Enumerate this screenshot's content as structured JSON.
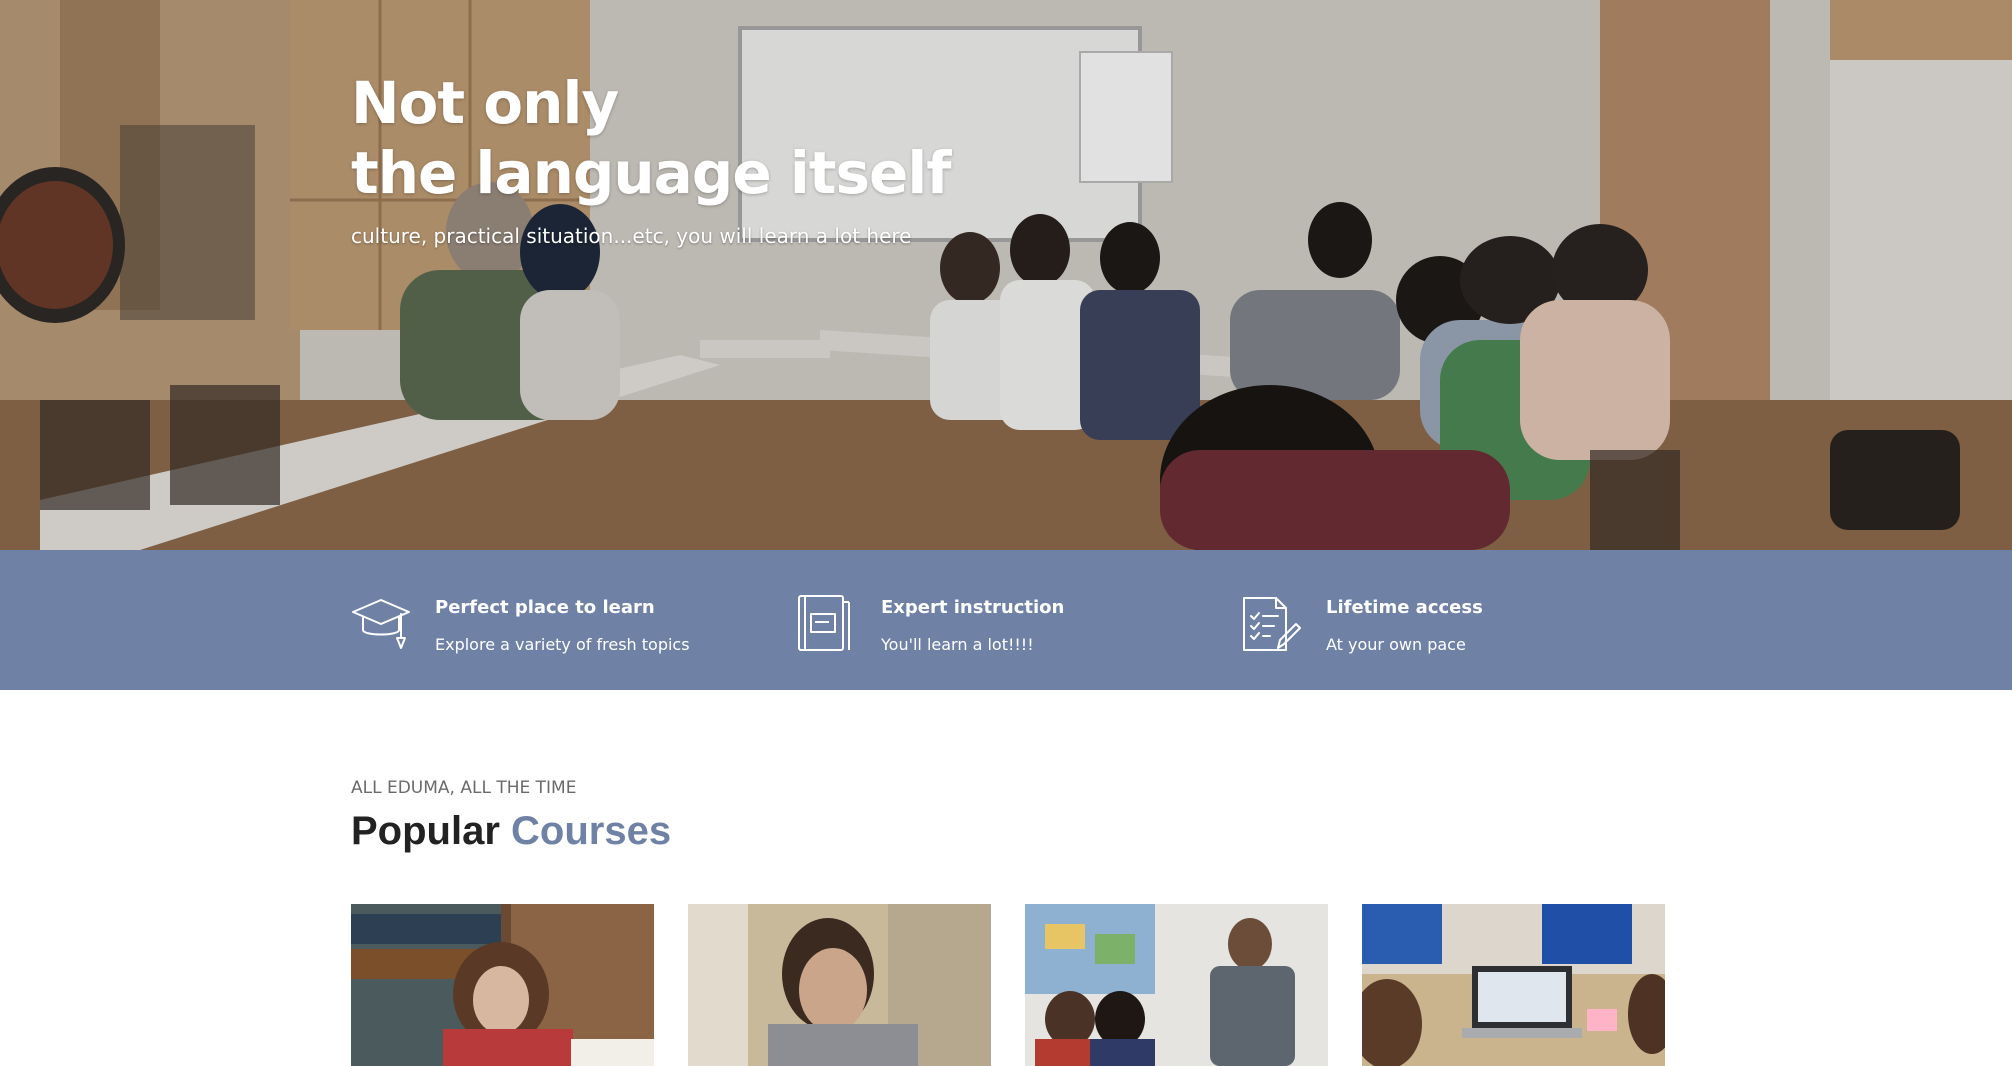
{
  "hero": {
    "title_line1": "Not only",
    "title_line2": "the language itself",
    "subtitle": "culture, practical situation...etc, you will learn a lot here"
  },
  "features": [
    {
      "icon": "graduation-cap-icon",
      "title": "Perfect place to learn",
      "description": "Explore a variety of fresh topics"
    },
    {
      "icon": "book-icon",
      "title": "Expert instruction",
      "description": "You'll learn a lot!!!!"
    },
    {
      "icon": "checklist-icon",
      "title": "Lifetime access",
      "description": "At your own pace"
    }
  ],
  "courses": {
    "eyebrow": "ALL EDUMA, ALL THE TIME",
    "heading_part1": "Popular",
    "heading_part2": "Courses",
    "cards": [
      {
        "image": "student-studying-library-photo"
      },
      {
        "image": "man-reading-photo"
      },
      {
        "image": "teacher-with-students-photo"
      },
      {
        "image": "laptop-table-photo"
      }
    ]
  },
  "colors": {
    "accent": "#6f82a6",
    "heading_dark": "#222222",
    "eyebrow_gray": "#6b6b6b",
    "white": "#ffffff"
  }
}
